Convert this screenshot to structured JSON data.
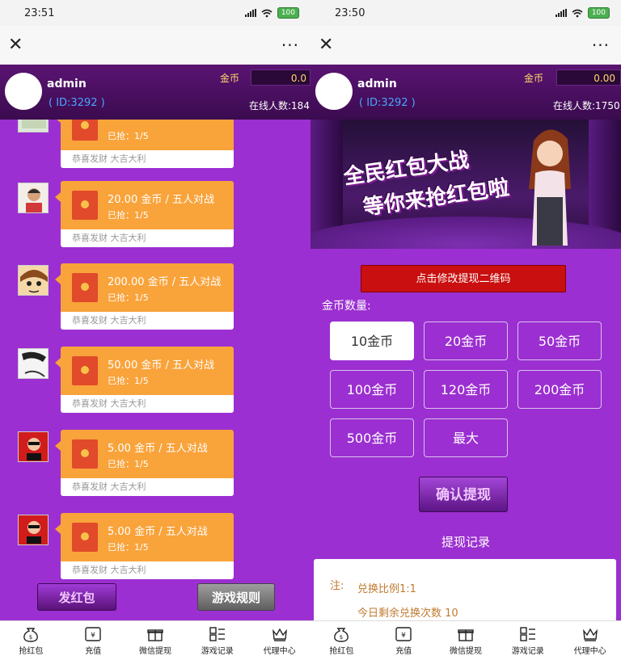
{
  "left": {
    "status": {
      "time": "23:51",
      "battery": "100"
    },
    "user": {
      "name": "admin",
      "id": "( ID:3292 )",
      "coins_label": "金币",
      "coins_value": "0.0",
      "online": "在线人数:184"
    },
    "messages": [
      {
        "title": "",
        "grabbed": "已抢：1/5",
        "footer": "恭喜发财 大吉大利"
      },
      {
        "title": "20.00 金币 / 五人对战",
        "grabbed": "已抢：1/5",
        "footer": "恭喜发财 大吉大利"
      },
      {
        "title": "200.00 金币 / 五人对战",
        "grabbed": "已抢：1/5",
        "footer": "恭喜发财 大吉大利"
      },
      {
        "title": "50.00 金币 / 五人对战",
        "grabbed": "已抢：1/5",
        "footer": "恭喜发财 大吉大利"
      },
      {
        "title": "5.00 金币 / 五人对战",
        "grabbed": "已抢：1/5",
        "footer": "恭喜发财 大吉大利"
      },
      {
        "title": "5.00 金币 / 五人对战",
        "grabbed": "已抢：1/5",
        "footer": "恭喜发财 大吉大利"
      }
    ],
    "send_button": "发红包",
    "rules_button": "游戏规则"
  },
  "right": {
    "status": {
      "time": "23:50",
      "battery": "100"
    },
    "user": {
      "name": "admin",
      "id": "( ID:3292 )",
      "coins_label": "金币",
      "coins_value": "0.00",
      "online": "在线人数:1750"
    },
    "banner": {
      "line1": "全民红包大战",
      "line2": "等你来抢红包啦"
    },
    "qr_button": "点击修改提现二维码",
    "quantity_label": "金币数量:",
    "options": [
      "10金币",
      "20金币",
      "50金币",
      "100金币",
      "120金币",
      "200金币",
      "500金币",
      "最大"
    ],
    "confirm_button": "确认提现",
    "records_title": "提现记录",
    "note_label": "注:",
    "note_ratio": "兑换比例1:1",
    "note_remaining": "今日剩余兑换次数 10"
  },
  "tabs": [
    "抢红包",
    "充值",
    "微信提现",
    "游戏记录",
    "代理中心"
  ],
  "colors": {
    "purple_bg": "#9b2fd1",
    "card_orange": "#f9a33b",
    "red_button": "#c90f0f"
  },
  "icons": {
    "close": "close-icon",
    "more": "more-icon",
    "money_bag": "money-bag-icon",
    "yuan": "yuan-icon",
    "gift": "gift-icon",
    "records": "records-icon",
    "crown": "crown-icon"
  }
}
